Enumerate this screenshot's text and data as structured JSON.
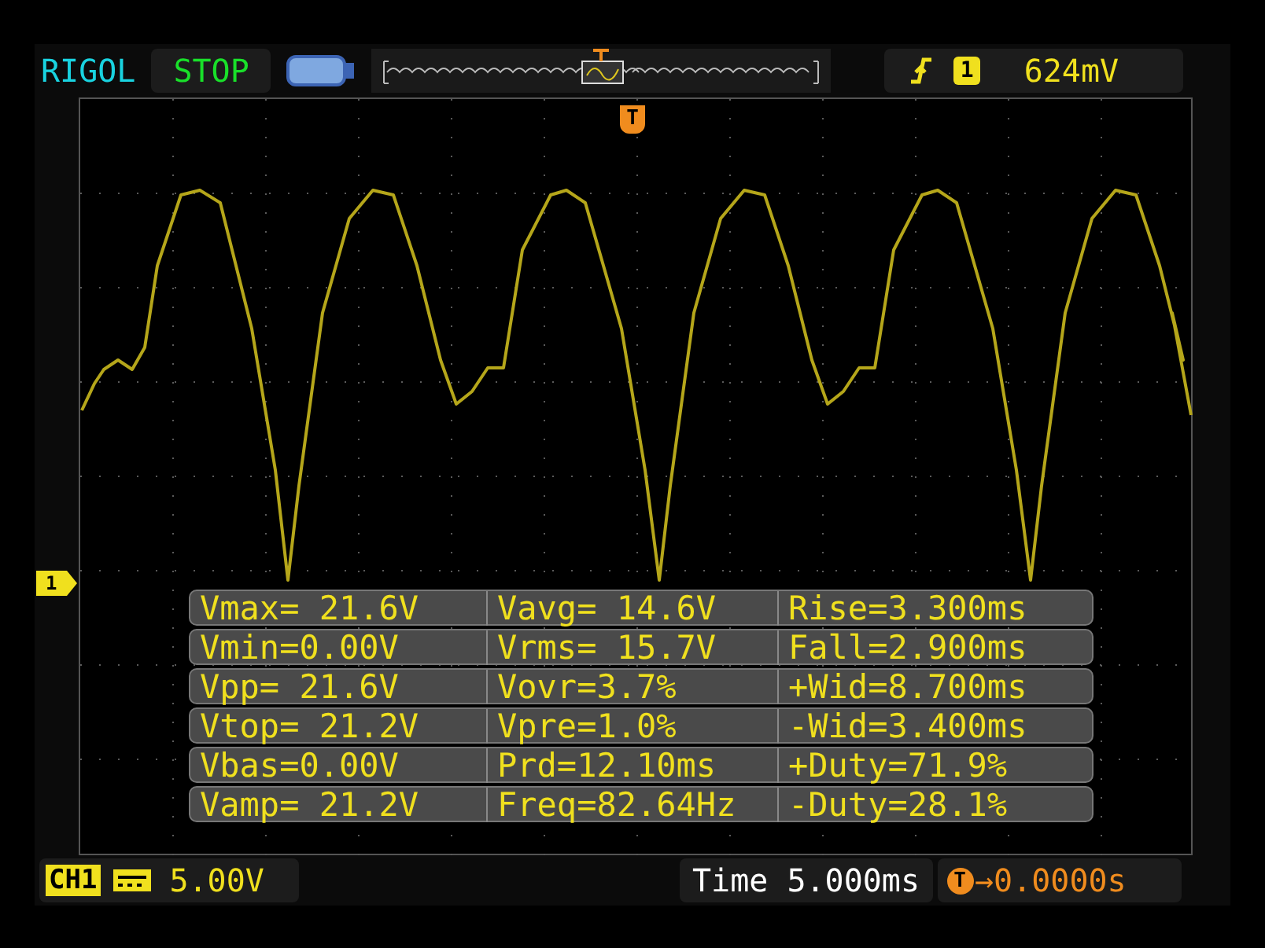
{
  "header": {
    "brand": "RIGOL",
    "run_state": "STOP",
    "trigger": {
      "source": "1",
      "level": "624mV"
    }
  },
  "trigger_marker": "T",
  "channel_marker": "1",
  "measurements": [
    {
      "cells": [
        "Vmax= 21.6V",
        "Vavg= 14.6V",
        "Rise=3.300ms"
      ]
    },
    {
      "cells": [
        "Vmin=0.00V",
        "Vrms= 15.7V",
        "Fall=2.900ms"
      ]
    },
    {
      "cells": [
        "Vpp= 21.6V",
        "Vovr=3.7%",
        "+Wid=8.700ms"
      ]
    },
    {
      "cells": [
        "Vtop= 21.2V",
        "Vpre=1.0%",
        "-Wid=3.400ms"
      ]
    },
    {
      "cells": [
        "Vbas=0.00V",
        "Prd=12.10ms",
        "+Duty=71.9%"
      ]
    },
    {
      "cells": [
        "Vamp= 21.2V",
        "Freq=82.64Hz",
        "-Duty=28.1%"
      ]
    }
  ],
  "footer": {
    "channel": "CH1",
    "volts_per_div": "5.00V",
    "timebase": "Time 5.000ms",
    "trigger_offset_icon": "T",
    "trigger_offset": "→0.0000s"
  }
}
